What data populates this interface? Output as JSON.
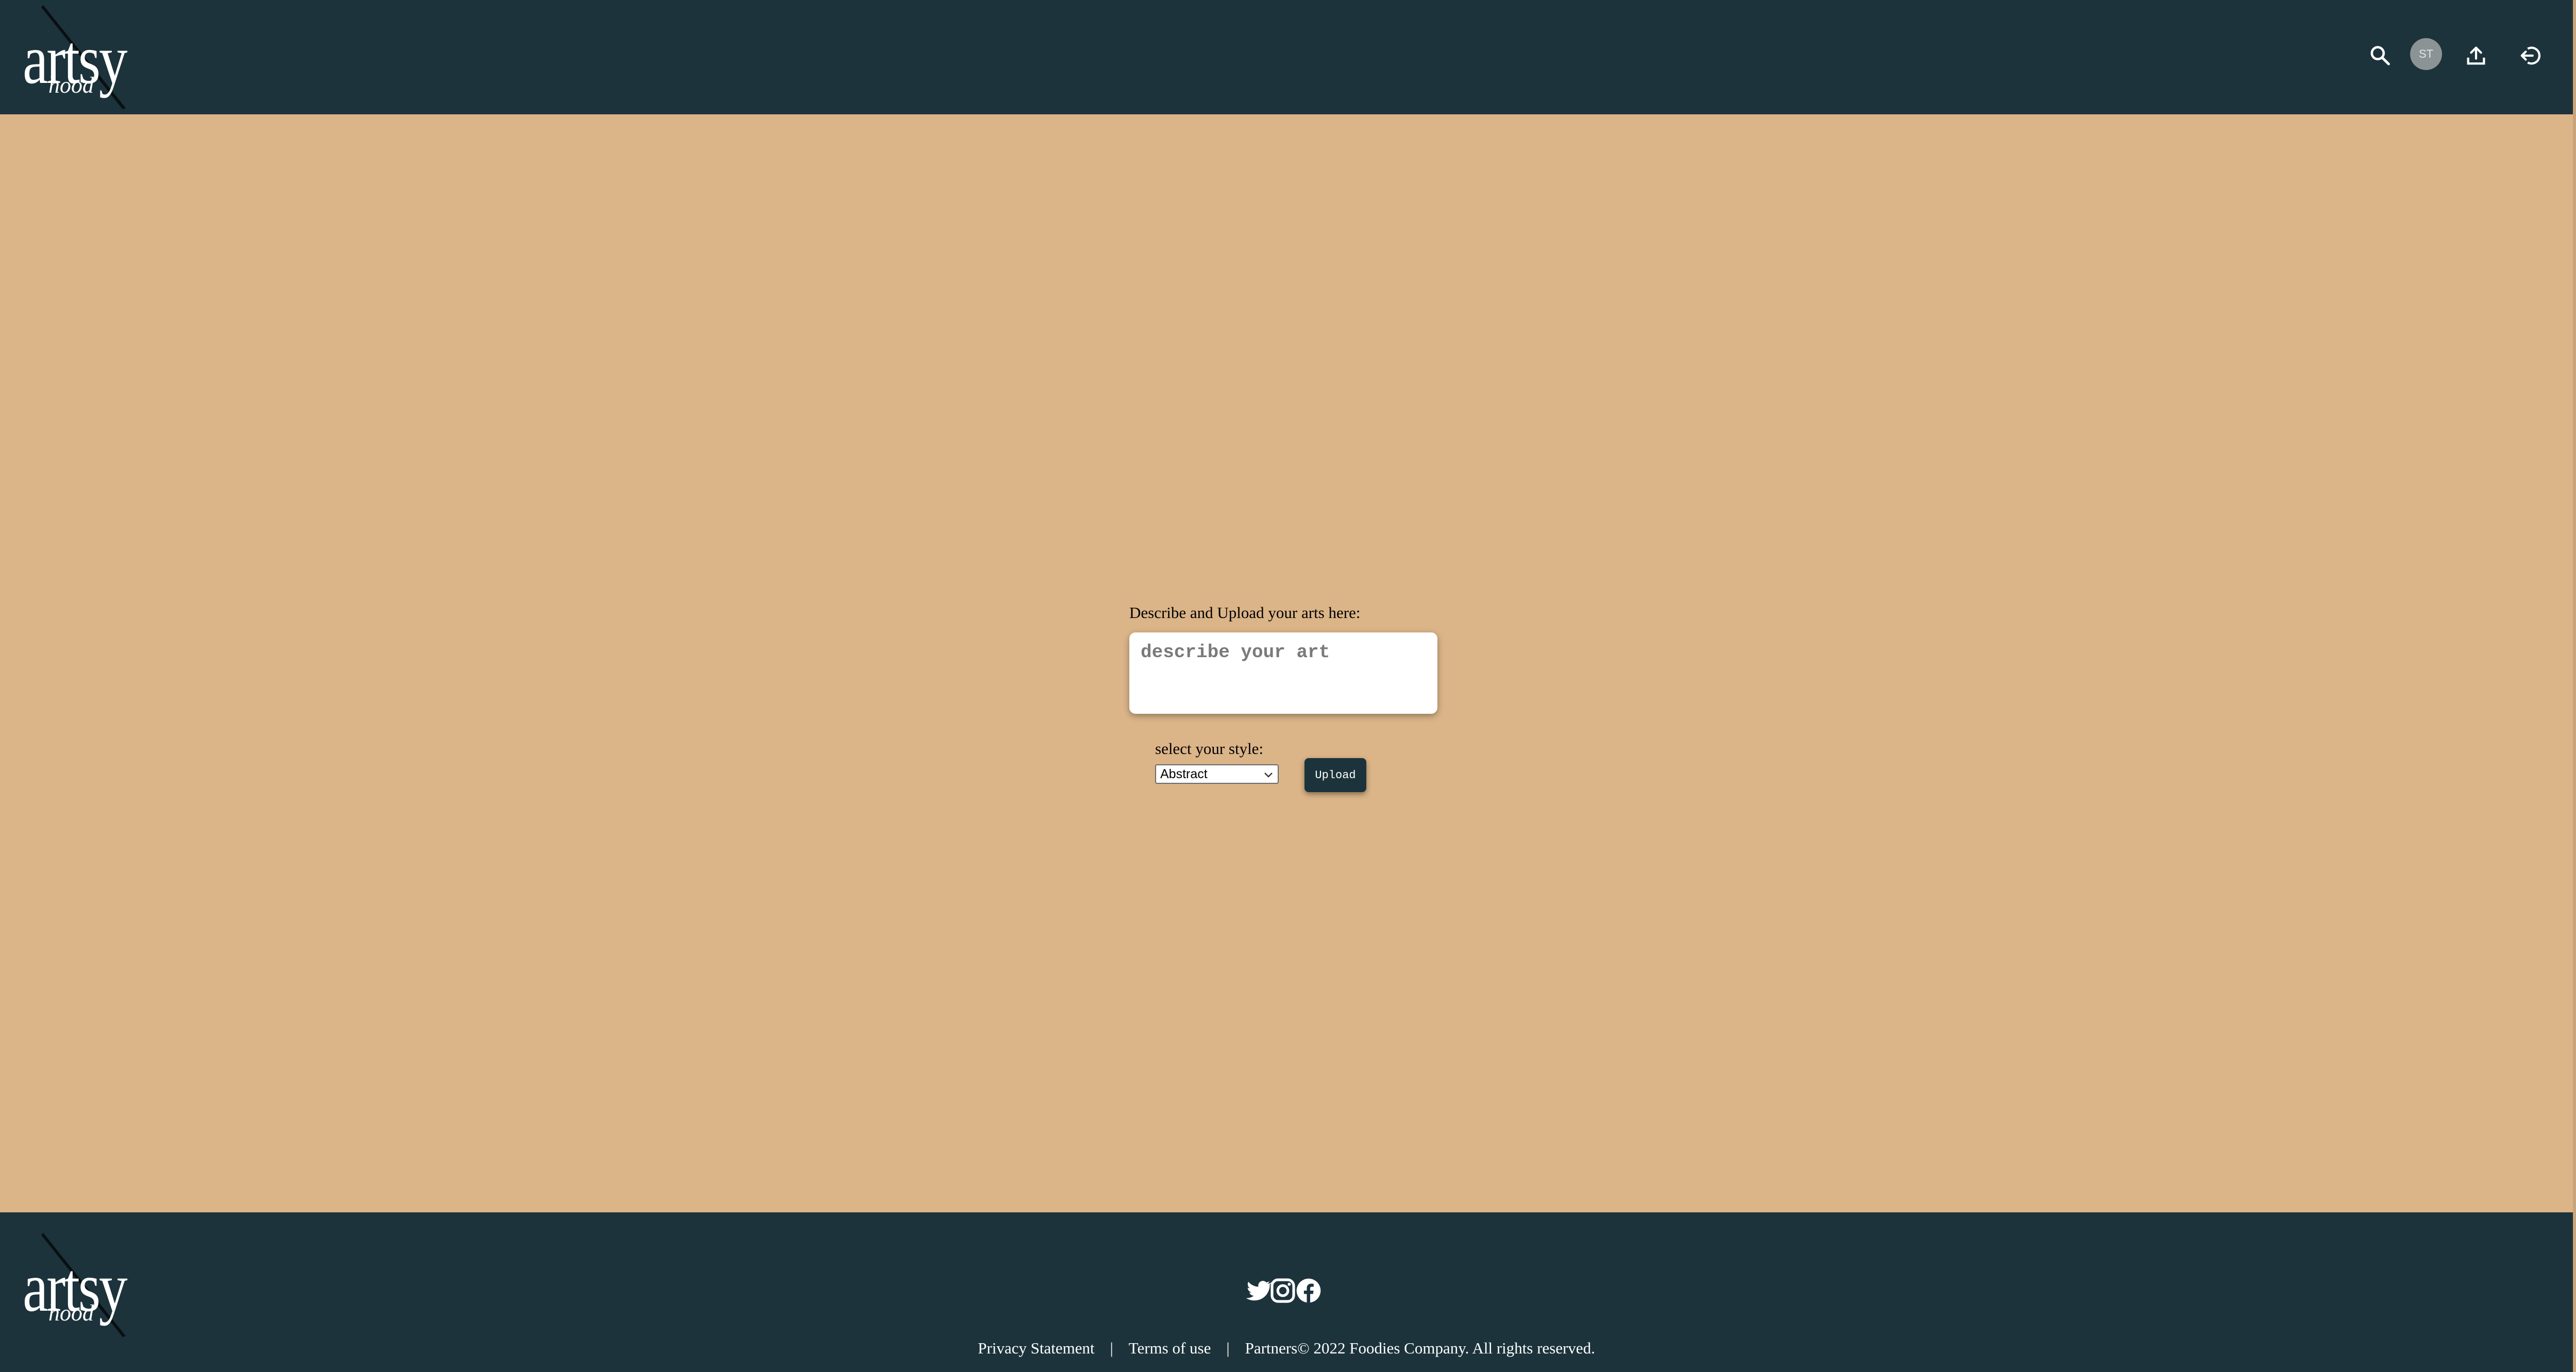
{
  "header": {
    "logo": {
      "main": "artsy",
      "sub": "hood"
    },
    "avatar_initials": "ST",
    "icons": [
      "search-icon",
      "upload-icon",
      "logout-icon"
    ]
  },
  "form": {
    "title": "Describe and Upload your arts here:",
    "describe_placeholder": "describe your art",
    "style_label": "select your style:",
    "style_selected": "Abstract",
    "upload_label": "Upload"
  },
  "footer": {
    "logo": {
      "main": "artsy",
      "sub": "hood"
    },
    "social_icons": [
      "twitter-icon",
      "instagram-icon",
      "facebook-icon"
    ],
    "links": {
      "privacy": "Privacy Statement",
      "terms": "Terms of use",
      "partners": "Partners",
      "copyright": "© 2022 Foodies Company. All rights reserved.",
      "separator": "|"
    }
  },
  "colors": {
    "header_bg": "#1c333b",
    "page_bg": "#dbb488",
    "button_bg": "#1c333b"
  }
}
